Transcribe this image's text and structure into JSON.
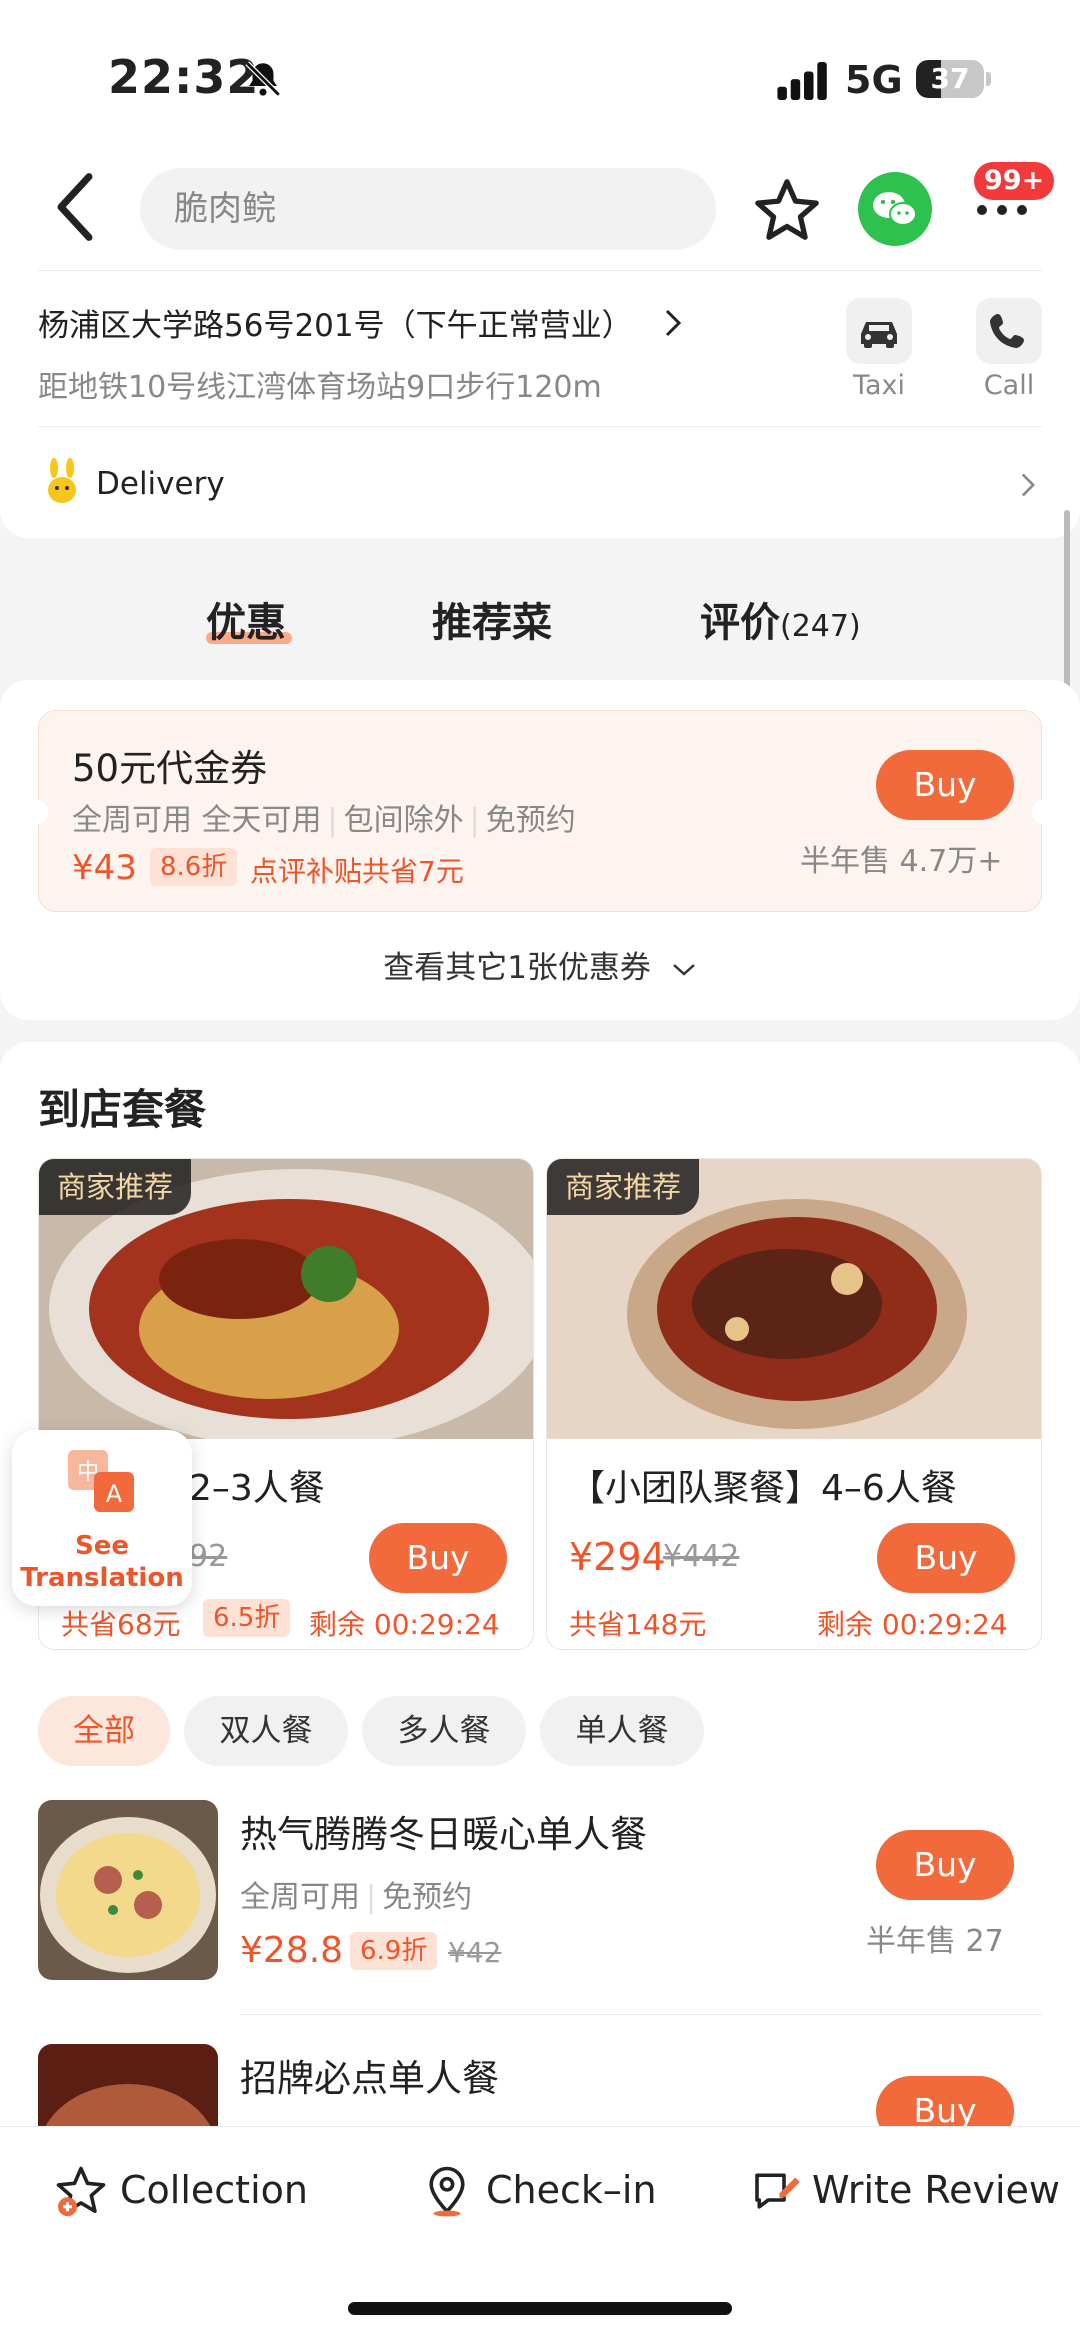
{
  "status_bar": {
    "time": "22:32",
    "network": "5G",
    "battery": "37",
    "battery_level": 0.37
  },
  "header": {
    "search_placeholder": "脆肉鲩",
    "notification_badge": "99+"
  },
  "store": {
    "address": "杨浦区大学路56号201号（下午正常营业）",
    "subway": "距地铁10号线江湾体育场站9口步行120m",
    "taxi_label": "Taxi",
    "call_label": "Call",
    "delivery_label": "Delivery"
  },
  "tabs": [
    {
      "label": "优惠",
      "count": ""
    },
    {
      "label": "推荐菜",
      "count": ""
    },
    {
      "label": "评价",
      "count": "(247)"
    }
  ],
  "coupon": {
    "title": "50元代金券",
    "tags": [
      "全周可用 全天可用",
      "包间除外",
      "免预约"
    ],
    "price": "¥43",
    "discount": "8.6折",
    "subsidy": "点评补贴共省7元",
    "buy_label": "Buy",
    "sold": "半年售 4.7万+",
    "more_label": "查看其它1张优惠券"
  },
  "combos": {
    "title": "到店套餐",
    "items": [
      {
        "tag": "商家推荐",
        "name": "2–3人餐",
        "price": "",
        "orig": "92",
        "buy_label": "Buy",
        "save": "共省68元",
        "discount": "6.5折",
        "remain": "剩余 00:29:24"
      },
      {
        "tag": "商家推荐",
        "name": "【小团队聚餐】4–6人餐",
        "price": "¥294",
        "orig": "¥442",
        "buy_label": "Buy",
        "save": "共省148元",
        "discount": "",
        "remain": "剩余 00:29:24"
      }
    ]
  },
  "translation": {
    "label": "See Translation"
  },
  "filters": [
    "全部",
    "双人餐",
    "多人餐",
    "单人餐"
  ],
  "list_items": [
    {
      "name": "热气腾腾冬日暖心单人餐",
      "tags": [
        "全周可用",
        "免预约"
      ],
      "price": "¥28.8",
      "discount": "6.9折",
      "orig": "¥42",
      "buy_label": "Buy",
      "sold": "半年售 27"
    },
    {
      "name": "招牌必点单人餐",
      "buy_label": "Buy"
    }
  ],
  "bottom_bar": {
    "collection": "Collection",
    "checkin": "Check–in",
    "review": "Write Review"
  },
  "colors": {
    "accent": "#f26a3c",
    "price": "#f0552a",
    "wechat": "#2fc14e",
    "badge": "#f23a3a"
  }
}
